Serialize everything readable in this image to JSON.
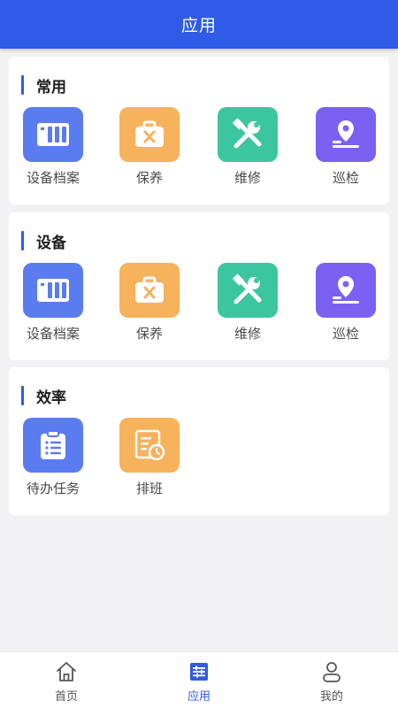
{
  "header": {
    "title": "应用"
  },
  "colors": {
    "primary": "#2f5be6",
    "tile_blue": "#5b7cf0",
    "tile_orange": "#f7b25c",
    "tile_green": "#3cc69f",
    "tile_purple": "#7b61f2"
  },
  "sections": [
    {
      "title": "常用",
      "apps": [
        {
          "label": "设备档案",
          "icon": "equipment-archive-icon",
          "color": "#5b7cf0"
        },
        {
          "label": "保养",
          "icon": "maintenance-toolbox-icon",
          "color": "#f7b25c"
        },
        {
          "label": "维修",
          "icon": "repair-tools-icon",
          "color": "#3cc69f"
        },
        {
          "label": "巡检",
          "icon": "patrol-location-icon",
          "color": "#7b61f2"
        }
      ]
    },
    {
      "title": "设备",
      "apps": [
        {
          "label": "设备档案",
          "icon": "equipment-archive-icon",
          "color": "#5b7cf0"
        },
        {
          "label": "保养",
          "icon": "maintenance-toolbox-icon",
          "color": "#f7b25c"
        },
        {
          "label": "维修",
          "icon": "repair-tools-icon",
          "color": "#3cc69f"
        },
        {
          "label": "巡检",
          "icon": "patrol-location-icon",
          "color": "#7b61f2"
        }
      ]
    },
    {
      "title": "效率",
      "apps": [
        {
          "label": "待办任务",
          "icon": "todo-clipboard-icon",
          "color": "#5b7cf0"
        },
        {
          "label": "排班",
          "icon": "schedule-clock-icon",
          "color": "#f7b25c"
        }
      ]
    }
  ],
  "tabbar": {
    "items": [
      {
        "label": "首页",
        "icon": "home-icon",
        "active": false
      },
      {
        "label": "应用",
        "icon": "apps-menu-icon",
        "active": true
      },
      {
        "label": "我的",
        "icon": "user-icon",
        "active": false
      }
    ]
  }
}
